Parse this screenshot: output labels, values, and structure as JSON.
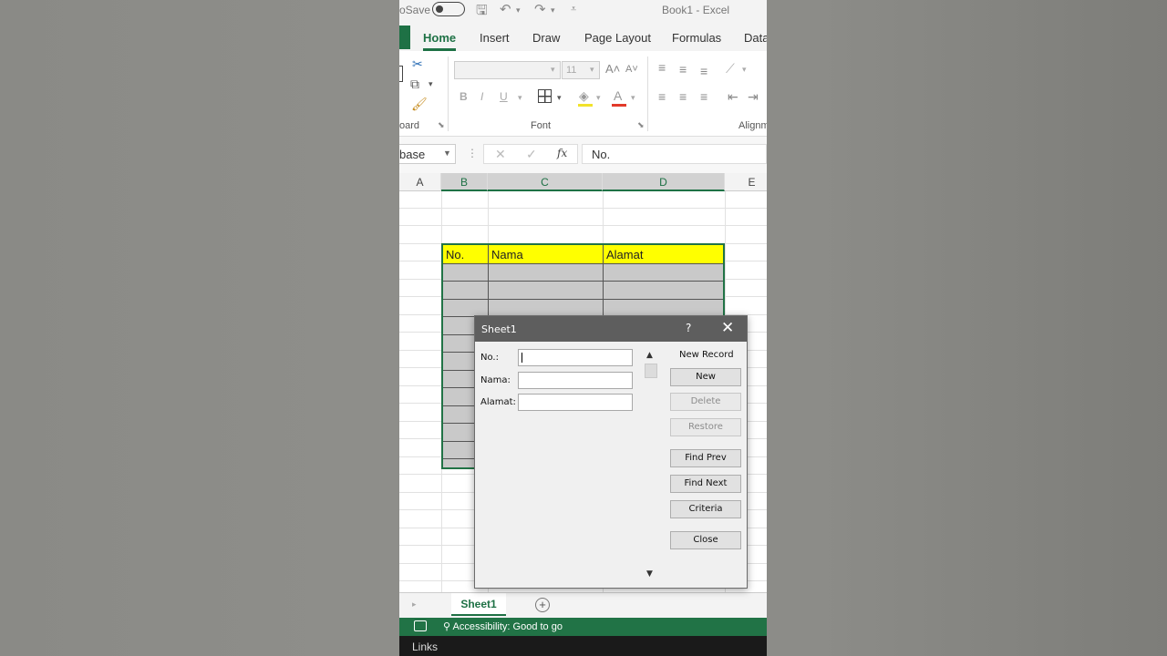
{
  "titlebar": {
    "autosave": "oSave",
    "doc_title": "Book1  -  Excel"
  },
  "tabs": [
    {
      "label": "Home"
    },
    {
      "label": "Insert"
    },
    {
      "label": "Draw"
    },
    {
      "label": "Page Layout"
    },
    {
      "label": "Formulas"
    },
    {
      "label": "Data"
    }
  ],
  "ribbon": {
    "font_size": "11",
    "groups": {
      "clipboard": "oard",
      "font": "Font",
      "alignment": "Alignm"
    }
  },
  "formula_bar": {
    "name_box": "base",
    "fx": "fx",
    "content": "No."
  },
  "columns": [
    "A",
    "B",
    "C",
    "D",
    "E"
  ],
  "table": {
    "headers": [
      "No.",
      "Nama",
      "Alamat"
    ]
  },
  "dialog": {
    "title": "Sheet1",
    "help": "?",
    "fields": [
      {
        "label": "No.:",
        "value": ""
      },
      {
        "label": "Nama:",
        "value": ""
      },
      {
        "label": "Alamat:",
        "value": ""
      }
    ],
    "record_status": "New Record",
    "buttons": {
      "new": "New",
      "delete": "Delete",
      "restore": "Restore",
      "find_prev": "Find Prev",
      "find_next": "Find Next",
      "criteria": "Criteria",
      "close": "Close"
    }
  },
  "sheet_tab": "Sheet1",
  "status": {
    "accessibility": "Accessibility: Good to go"
  },
  "links_bar": "Links",
  "colors": {
    "excel_green": "#217346",
    "header_yellow": "#ffff00"
  }
}
